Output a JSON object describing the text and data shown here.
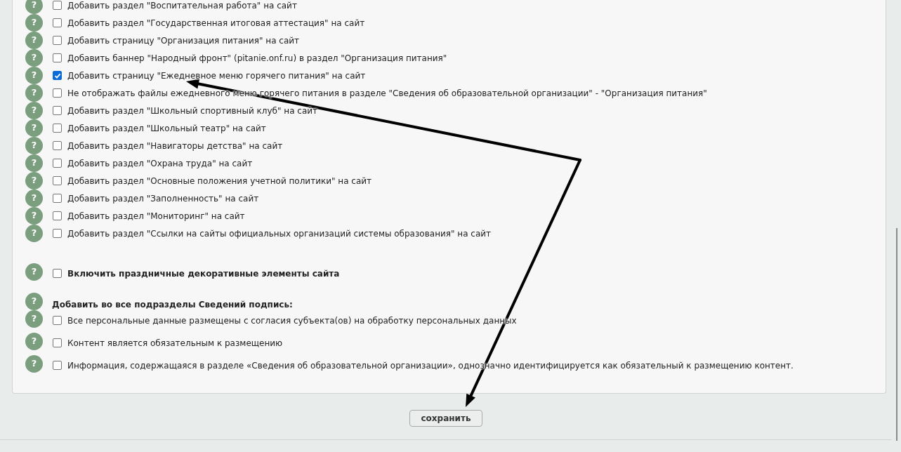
{
  "options": [
    {
      "help": "?",
      "label": "Добавить раздел \"Воспитательная работа\" на сайт",
      "checked": false
    },
    {
      "help": "?",
      "label": "Добавить раздел \"Государственная итоговая аттестация\" на сайт",
      "checked": false
    },
    {
      "help": "?",
      "label": "Добавить страницу \"Организация питания\" на сайт",
      "checked": false
    },
    {
      "help": "?",
      "label": "Добавить баннер \"Народный фронт\" (pitanie.onf.ru) в раздел \"Организация питания\"",
      "checked": false
    },
    {
      "help": "?",
      "label": "Добавить страницу \"Ежедневное меню горячего питания\" на сайт",
      "checked": true
    },
    {
      "help": "?",
      "label": "Не отображать файлы ежедневного меню горячего питания в разделе \"Сведения об образовательной организации\" - \"Организация питания\"",
      "checked": false
    },
    {
      "help": "?",
      "label": "Добавить раздел \"Школьный спортивный клуб\" на сайт",
      "checked": false
    },
    {
      "help": "?",
      "label": "Добавить раздел \"Школьный театр\" на сайт",
      "checked": false
    },
    {
      "help": "?",
      "label": "Добавить раздел \"Навигаторы детства\" на сайт",
      "checked": false
    },
    {
      "help": "?",
      "label": "Добавить раздел \"Охрана труда\" на сайт",
      "checked": false
    },
    {
      "help": "?",
      "label": "Добавить раздел \"Основные положения учетной политики\" на сайт",
      "checked": false
    },
    {
      "help": "?",
      "label": "Добавить раздел \"Заполненность\" на сайт",
      "checked": false
    },
    {
      "help": "?",
      "label": "Добавить раздел \"Мониторинг\" на сайт",
      "checked": false
    },
    {
      "help": "?",
      "label": "Добавить раздел \"Ссылки на сайты официальных организаций системы образования\" на сайт",
      "checked": false
    }
  ],
  "decor_option": {
    "help": "?",
    "label": "Включить праздничные декоративные элементы сайта",
    "checked": false
  },
  "signature": {
    "help": "?",
    "heading": "Добавить во все подразделы Сведений подпись:",
    "options": [
      {
        "help": "?",
        "label": "Все персональные данные размещены с согласия субъекта(ов) на обработку персональных данных",
        "checked": false
      },
      {
        "help": "?",
        "label": "Контент является обязательным к размещению",
        "checked": false
      },
      {
        "help": "?",
        "label": "Информация, содержащаяся в разделе «Сведения об образовательной организации», однозначно идентифицируется как обязательный к размещению контент.",
        "checked": false
      }
    ]
  },
  "save_button": "сохранить"
}
